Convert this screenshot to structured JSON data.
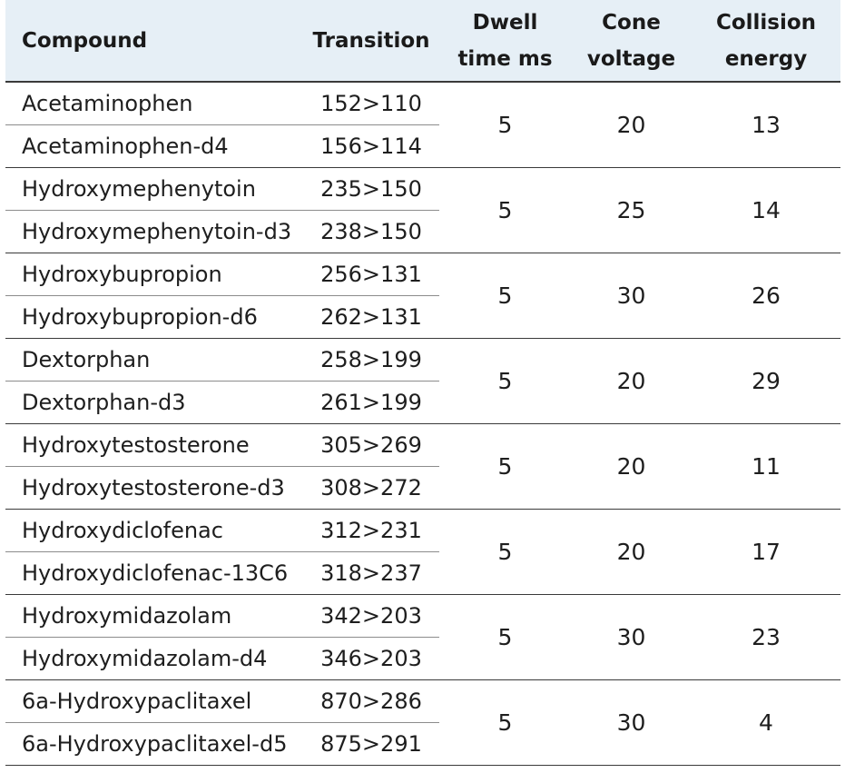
{
  "headers": {
    "compound": "Compound",
    "transition": "Transition",
    "dwell_line1": "Dwell",
    "dwell_line2": "time ms",
    "cone_line1": "Cone",
    "cone_line2": "voltage",
    "collision_line1": "Collision",
    "collision_line2": "energy"
  },
  "groups": [
    {
      "rows": [
        {
          "compound": "Acetaminophen",
          "transition": "152>110"
        },
        {
          "compound": "Acetaminophen-d4",
          "transition": "156>114"
        }
      ],
      "dwell": "5",
      "cone": "20",
      "collision": "13"
    },
    {
      "rows": [
        {
          "compound": "Hydroxymephenytoin",
          "transition": "235>150"
        },
        {
          "compound": "Hydroxymephenytoin-d3",
          "transition": "238>150"
        }
      ],
      "dwell": "5",
      "cone": "25",
      "collision": "14"
    },
    {
      "rows": [
        {
          "compound": "Hydroxybupropion",
          "transition": "256>131"
        },
        {
          "compound": "Hydroxybupropion-d6",
          "transition": "262>131"
        }
      ],
      "dwell": "5",
      "cone": "30",
      "collision": "26"
    },
    {
      "rows": [
        {
          "compound": "Dextorphan",
          "transition": "258>199"
        },
        {
          "compound": "Dextorphan-d3",
          "transition": "261>199"
        }
      ],
      "dwell": "5",
      "cone": "20",
      "collision": "29"
    },
    {
      "rows": [
        {
          "compound": "Hydroxytestosterone",
          "transition": "305>269"
        },
        {
          "compound": "Hydroxytestosterone-d3",
          "transition": "308>272"
        }
      ],
      "dwell": "5",
      "cone": "20",
      "collision": "11"
    },
    {
      "rows": [
        {
          "compound": "Hydroxydiclofenac",
          "transition": "312>231"
        },
        {
          "compound": "Hydroxydiclofenac-13C6",
          "transition": "318>237"
        }
      ],
      "dwell": "5",
      "cone": "20",
      "collision": "17"
    },
    {
      "rows": [
        {
          "compound": "Hydroxymidazolam",
          "transition": "342>203"
        },
        {
          "compound": "Hydroxymidazolam-d4",
          "transition": "346>203"
        }
      ],
      "dwell": "5",
      "cone": "30",
      "collision": "23"
    },
    {
      "rows": [
        {
          "compound": "6a-Hydroxypaclitaxel",
          "transition": "870>286"
        },
        {
          "compound": "6a-Hydroxypaclitaxel-d5",
          "transition": "875>291"
        }
      ],
      "dwell": "5",
      "cone": "30",
      "collision": "4"
    }
  ]
}
